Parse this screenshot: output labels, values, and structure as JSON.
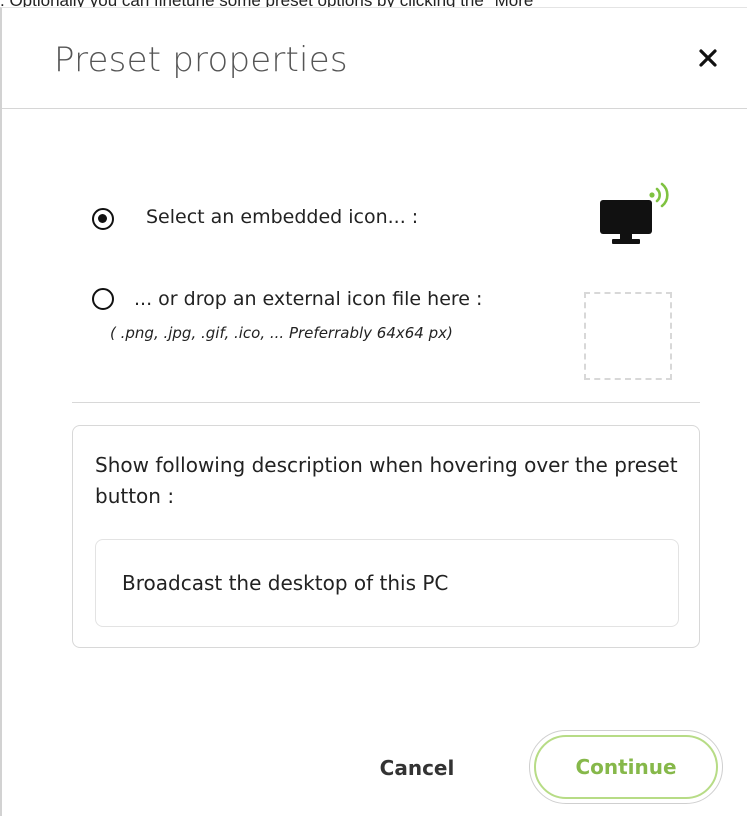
{
  "background_text": ". Optionally you can finetune some preset options by clicking the \"More",
  "dialog": {
    "title": "Preset properties",
    "close_icon": "close-icon"
  },
  "icon_options": {
    "embedded": {
      "label": "Select an embedded icon... :",
      "selected": true,
      "preview_icon": "monitor-broadcast-icon"
    },
    "external": {
      "label": "... or drop an external icon file here :",
      "hint": "( .png, .jpg, .gif, .ico, ... Preferrably 64x64 px)",
      "selected": false
    }
  },
  "description": {
    "label": "Show following description when hovering over the preset button :",
    "value": "Broadcast the desktop of this PC"
  },
  "footer": {
    "cancel_label": "Cancel",
    "continue_label": "Continue"
  },
  "colors": {
    "accent_border": "#b7dc86",
    "accent_text": "#86b84a",
    "title": "#555555"
  }
}
